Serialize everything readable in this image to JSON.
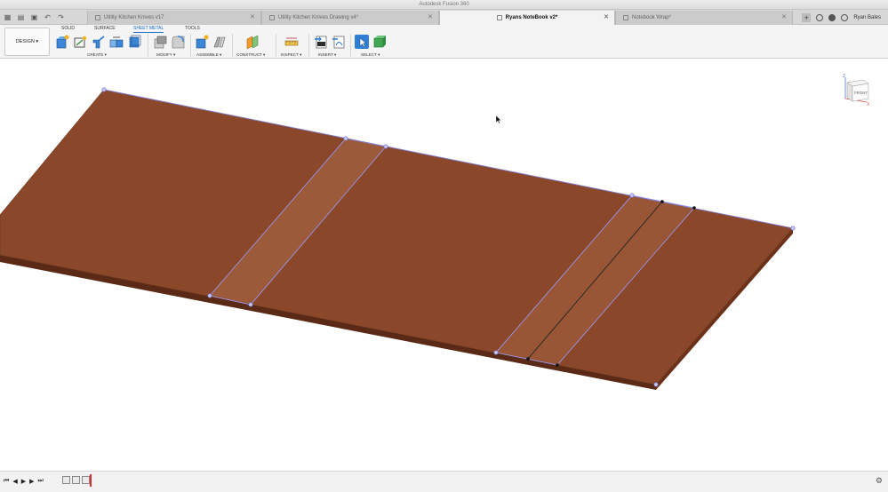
{
  "window": {
    "title": "Autodesk Fusion 360"
  },
  "tabs": [
    {
      "label": "Utility Kitchen Knives v17",
      "active": false
    },
    {
      "label": "Utility Kitchen Knives Drawing v4*",
      "active": false
    },
    {
      "label": "Ryans NoteBook v2*",
      "active": true
    },
    {
      "label": "Notebook Wrap*",
      "active": false
    }
  ],
  "user": {
    "name": "Ryan Bales"
  },
  "workspace": {
    "label": "DESIGN ▾"
  },
  "toolbar_tabs": [
    "SOLID",
    "SURFACE",
    "SHEET METAL",
    "TOOLS"
  ],
  "active_toolbar_tab": "SHEET METAL",
  "groups": {
    "create": "CREATE ▾",
    "modify": "MODIFY ▾",
    "assemble": "ASSEMBLE ▾",
    "construct": "CONSTRUCT ▾",
    "inspect": "INSPECT ▾",
    "insert": "INSERT ▾",
    "select": "SELECT ▾"
  },
  "viewcube": {
    "face": "FRONT",
    "axis_z": "Z",
    "axis_x": "X"
  },
  "colors": {
    "sheet": "#8b472a",
    "sheet_edge": "#5a2a16",
    "accent": "#1a6fd1"
  }
}
